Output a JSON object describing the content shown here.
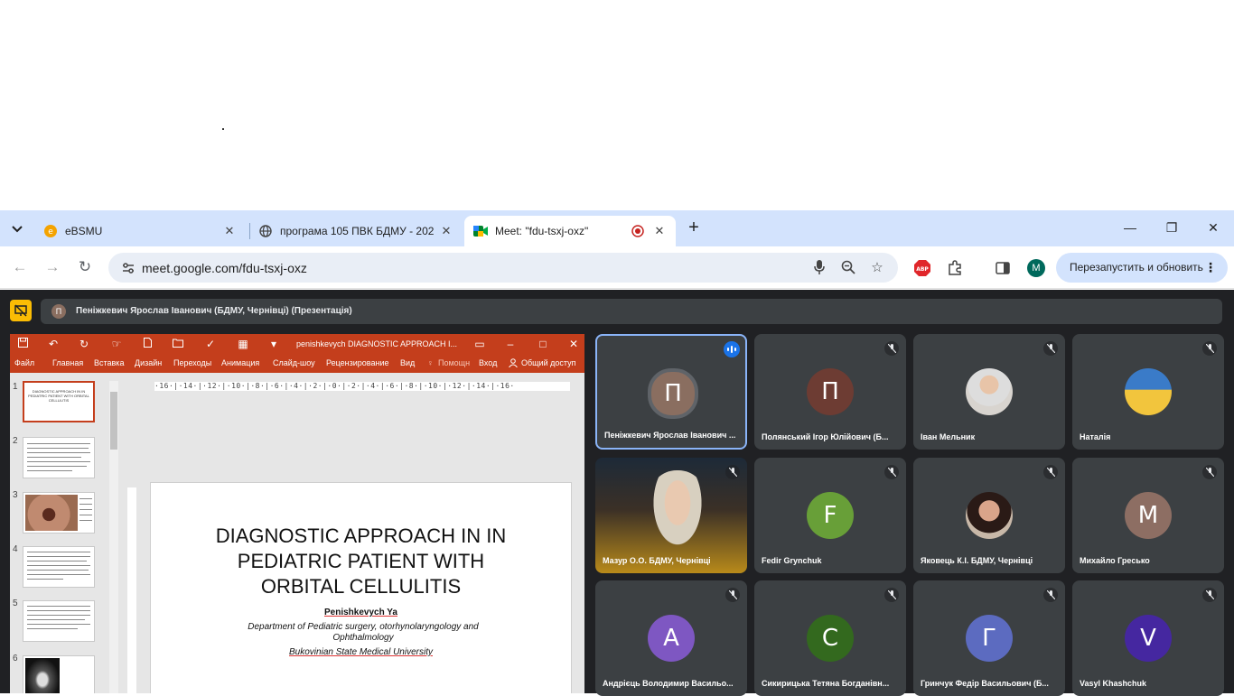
{
  "browser": {
    "tabs": [
      {
        "title": "eBSMU"
      },
      {
        "title": "програма 105 ПВК БДМУ - 202"
      },
      {
        "title": "Meet: \"fdu-tsxj-oxz\""
      }
    ],
    "url": "meet.google.com/fdu-tsxj-oxz",
    "profile_initial": "M",
    "adblock_label": "ABP",
    "relaunch_label": "Перезапустить и обновить"
  },
  "meet": {
    "presenter_initial": "П",
    "presenting_label": "Пеніжкевич Ярослав Іванович (БДМУ, Чернівці) (Презентація)",
    "participants": [
      {
        "name": "Пеніжкевич Ярослав Іванович ...",
        "initial": "П",
        "color": "#8a6e60",
        "speaking": true
      },
      {
        "name": "Полянський Ігор Юлійович (Б...",
        "initial": "П",
        "color": "#6d3c33"
      },
      {
        "name": "Іван Мельник",
        "initial": "",
        "color": "#c8c0b8"
      },
      {
        "name": "Наталія",
        "initial": "",
        "color": "#3a7bc8"
      },
      {
        "name": "Мазур О.О. БДМУ, Чернівці",
        "initial": "",
        "color": ""
      },
      {
        "name": "Fedir Grynchuk",
        "initial": "F",
        "color": "#689f38"
      },
      {
        "name": "Яковець К.І. БДМУ, Чернівці",
        "initial": "",
        "color": "#b07a6a"
      },
      {
        "name": "Михайло Гресько",
        "initial": "М",
        "color": "#8d6e63"
      },
      {
        "name": "Андрієць Володимир Васильо...",
        "initial": "А",
        "color": "#7e57c2"
      },
      {
        "name": "Сикирицька Тетяна Богданівн...",
        "initial": "С",
        "color": "#33691e"
      },
      {
        "name": "Гринчук Федір Васильович (Б...",
        "initial": "Г",
        "color": "#5c6bc0"
      },
      {
        "name": "Vasyl Khashchuk",
        "initial": "V",
        "color": "#4527a0"
      }
    ]
  },
  "ppt": {
    "doc_title": "penishkevych DIAGNOSTIC APPROACH I...",
    "menu": [
      "Файл",
      "Главная",
      "Вставка",
      "Дизайн",
      "Переходы",
      "Анимация",
      "Слайд-шоу",
      "Рецензирование",
      "Вид",
      "Помощн",
      "Вход",
      "Общий доступ"
    ],
    "thumb_numbers": [
      "1",
      "2",
      "3",
      "4",
      "5",
      "6"
    ],
    "thumb1_title": "DIAGNOSTIC APPROACH IN IN PEDIATRIC PATIENT WITH ORBITAL CELLULITIS",
    "ruler_h": "·16·|·14·|·12·|·10·|·8·|·6·|·4·|·2·|·0·|·2·|·4·|·6·|·8·|·10·|·12·|·14·|·16·",
    "slide": {
      "title_line1": "DIAGNOSTIC APPROACH IN IN",
      "title_line2": "PEDIATRIC PATIENT WITH",
      "title_line3": "ORBITAL CELLULITIS",
      "author": "Penishkevych Ya",
      "dept": "Department of Pediatric surgery, otorhynolaryngology and Ophthalmology",
      "university": "Bukovinian State Medical University"
    }
  }
}
